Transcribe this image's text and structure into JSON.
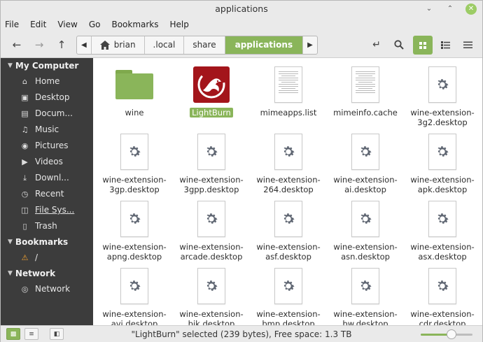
{
  "window": {
    "title": "applications"
  },
  "menu": [
    "File",
    "Edit",
    "View",
    "Go",
    "Bookmarks",
    "Help"
  ],
  "toolbar": {
    "path": [
      {
        "label": "brian",
        "icon": "home-icon"
      },
      {
        "label": ".local"
      },
      {
        "label": "share"
      },
      {
        "label": "applications",
        "active": true
      }
    ]
  },
  "sidebar": {
    "sections": [
      {
        "title": "My Computer",
        "items": [
          {
            "label": "Home",
            "icon": "home-icon"
          },
          {
            "label": "Desktop",
            "icon": "desktop-icon"
          },
          {
            "label": "Docum...",
            "icon": "documents-icon"
          },
          {
            "label": "Music",
            "icon": "music-icon"
          },
          {
            "label": "Pictures",
            "icon": "camera-icon"
          },
          {
            "label": "Videos",
            "icon": "video-icon"
          },
          {
            "label": "Downl...",
            "icon": "download-icon"
          },
          {
            "label": "Recent",
            "icon": "clock-icon"
          },
          {
            "label": "File Sys...",
            "icon": "drive-icon"
          },
          {
            "label": "Trash",
            "icon": "trash-icon"
          }
        ]
      },
      {
        "title": "Bookmarks",
        "items": [
          {
            "label": "/",
            "icon": "drive-warning-icon"
          }
        ]
      },
      {
        "title": "Network",
        "items": [
          {
            "label": "Network",
            "icon": "network-icon"
          }
        ]
      }
    ]
  },
  "files": [
    {
      "name": "wine",
      "type": "folder"
    },
    {
      "name": "LightBurn",
      "type": "app",
      "selected": true
    },
    {
      "name": "mimeapps.list",
      "type": "text"
    },
    {
      "name": "mimeinfo.cache",
      "type": "text"
    },
    {
      "name": "wine-extension-3g2.desktop",
      "type": "desktop"
    },
    {
      "name": "wine-extension-3gp.desktop",
      "type": "desktop"
    },
    {
      "name": "wine-extension-3gpp.desktop",
      "type": "desktop"
    },
    {
      "name": "wine-extension-264.desktop",
      "type": "desktop"
    },
    {
      "name": "wine-extension-ai.desktop",
      "type": "desktop"
    },
    {
      "name": "wine-extension-apk.desktop",
      "type": "desktop"
    },
    {
      "name": "wine-extension-apng.desktop",
      "type": "desktop"
    },
    {
      "name": "wine-extension-arcade.desktop",
      "type": "desktop"
    },
    {
      "name": "wine-extension-asf.desktop",
      "type": "desktop"
    },
    {
      "name": "wine-extension-asn.desktop",
      "type": "desktop"
    },
    {
      "name": "wine-extension-asx.desktop",
      "type": "desktop"
    },
    {
      "name": "wine-extension-avi.desktop",
      "type": "desktop"
    },
    {
      "name": "wine-extension-bik.desktop",
      "type": "desktop"
    },
    {
      "name": "wine-extension-bmp.desktop",
      "type": "desktop"
    },
    {
      "name": "wine-extension-bw.desktop",
      "type": "desktop"
    },
    {
      "name": "wine-extension-cdr.desktop",
      "type": "desktop"
    }
  ],
  "status": {
    "text": "\"LightBurn\" selected (239 bytes), Free space: 1.3 TB",
    "zoom_fraction": 0.6
  },
  "colors": {
    "accent": "#8ab55a",
    "sidebar_bg": "#3c3c3c"
  }
}
